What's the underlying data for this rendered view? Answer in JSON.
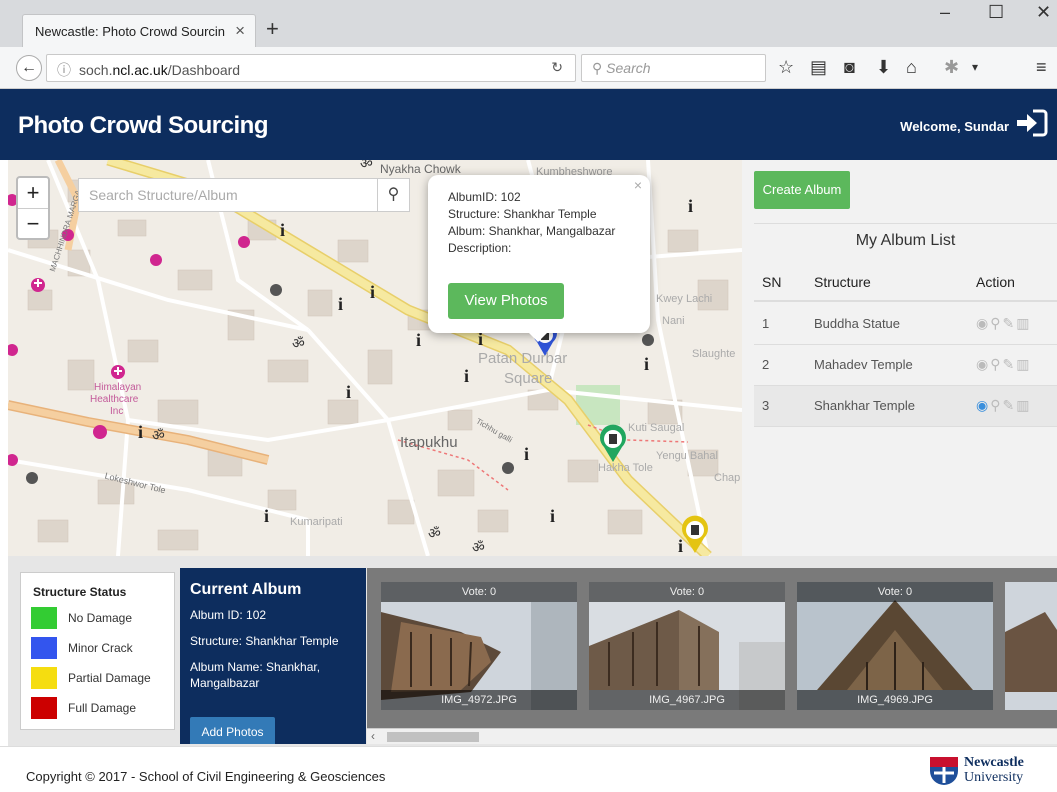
{
  "browser": {
    "tab_title": "Newcastle: Photo Crowd Sourcin",
    "url_prefix": "soch.",
    "url_domain": "ncl.ac.uk",
    "url_path": "/Dashboard",
    "search_placeholder": "Search"
  },
  "header": {
    "title": "Photo Crowd Sourcing",
    "welcome": "Welcome, Sundar"
  },
  "map": {
    "search_placeholder": "Search Structure/Album",
    "zoom_in": "+",
    "zoom_out": "−",
    "labels": {
      "nyakha": "Nyakha Chowk",
      "kumbheshwore": "Kumbheshwore",
      "patan": "Patan Durbar",
      "square": "Square",
      "itapukhu": "Itapukhu",
      "kuti": "Kuti Saugal",
      "hakha": "Hakha Tole",
      "yengu": "Yengu Bahal",
      "kumaripati": "Kumaripati",
      "himalayan": "Himalayan",
      "healthcare": "Healthcare",
      "inc": "Inc",
      "machhindra": "MACHHINDRA MARGA",
      "lagankhel": "Lokeshwor Tole",
      "kwey": "Kwey Lachi",
      "nani": "Nani",
      "slaughter": "Slaughte",
      "chap": "Chap",
      "tichhu": "Tichhu galli"
    },
    "popup": {
      "album_id": "AlbumID: 102",
      "structure": "Structure: Shankhar Temple",
      "album": "Album: Shankhar, Mangalbazar",
      "description": "Description:",
      "button": "View Photos",
      "close": "×"
    }
  },
  "right_panel": {
    "create_button": "Create Album",
    "list_title": "My Album List",
    "columns": [
      "SN",
      "Structure",
      "Action"
    ],
    "rows": [
      {
        "sn": "1",
        "structure": "Buddha Statue"
      },
      {
        "sn": "2",
        "structure": "Mahadev Temple"
      },
      {
        "sn": "3",
        "structure": "Shankhar Temple"
      }
    ]
  },
  "legend": {
    "title": "Structure Status",
    "items": [
      {
        "label": "No Damage",
        "color": "#33cc33"
      },
      {
        "label": "Minor Crack",
        "color": "#3355ee"
      },
      {
        "label": "Partial Damage",
        "color": "#f5dd10"
      },
      {
        "label": "Full Damage",
        "color": "#cc0000"
      }
    ]
  },
  "current_album": {
    "title": "Current Album",
    "album_id": "Album ID: 102",
    "structure": "Structure: Shankhar Temple",
    "album_name": "Album Name: Shankhar, Mangalbazar",
    "add_button": "Add Photos"
  },
  "photos": [
    {
      "vote": "Vote: 0",
      "file": "IMG_4972.JPG"
    },
    {
      "vote": "Vote: 0",
      "file": "IMG_4967.JPG"
    },
    {
      "vote": "Vote: 0",
      "file": "IMG_4969.JPG"
    }
  ],
  "footer": {
    "copyright": "Copyright © 2017 - School of Civil Engineering & Geosciences",
    "logo_line1": "Newcastle",
    "logo_line2": "University"
  }
}
